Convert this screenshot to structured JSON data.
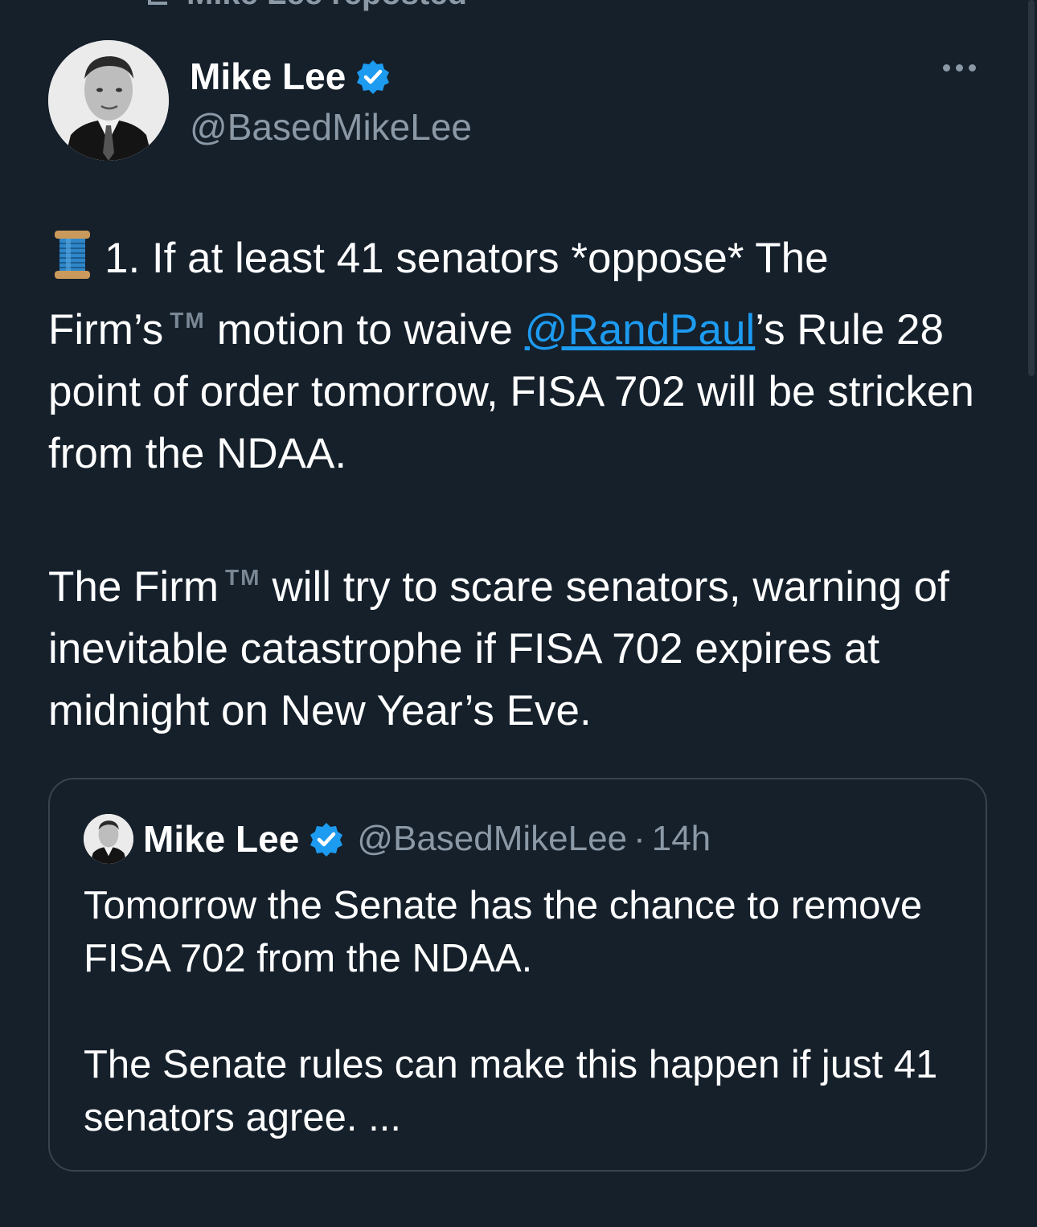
{
  "repost": {
    "label": "Mike Lee reposted",
    "icon": "repost-icon"
  },
  "author": {
    "name": "Mike Lee",
    "handle": "@BasedMikeLee",
    "verified_icon": "verified-badge-icon",
    "verified_color": "#1d9bf0"
  },
  "menu": {
    "icon": "more-options-icon"
  },
  "tweet": {
    "emoji": "spool-of-thread-emoji",
    "p1_part1": "1. If at least 41 senators *oppose* The Firm’s",
    "tm": "TM",
    "p1_part2": "motion to waive",
    "mention": "@RandPaul",
    "p1_part3": "’s Rule 28 point of order tomorrow, FISA 702 will be stricken from the NDAA.",
    "p2_part1": "The Firm",
    "p2_part2": "will try to scare senators, warning of inevitable catastrophe if FISA 702 expires at midnight on New Year’s Eve."
  },
  "quote": {
    "name": "Mike Lee",
    "handle": "@BasedMikeLee",
    "dot": "·",
    "time": "14h",
    "p1": "Tomorrow the Senate has the chance to remove FISA 702 from the NDAA.",
    "p2": "The Senate rules can make this happen if just 41 senators agree. ..."
  },
  "colors": {
    "background": "#15202b",
    "text": "#ffffff",
    "secondary": "#8b98a5",
    "link": "#1d9bf0",
    "border": "#38444d"
  }
}
